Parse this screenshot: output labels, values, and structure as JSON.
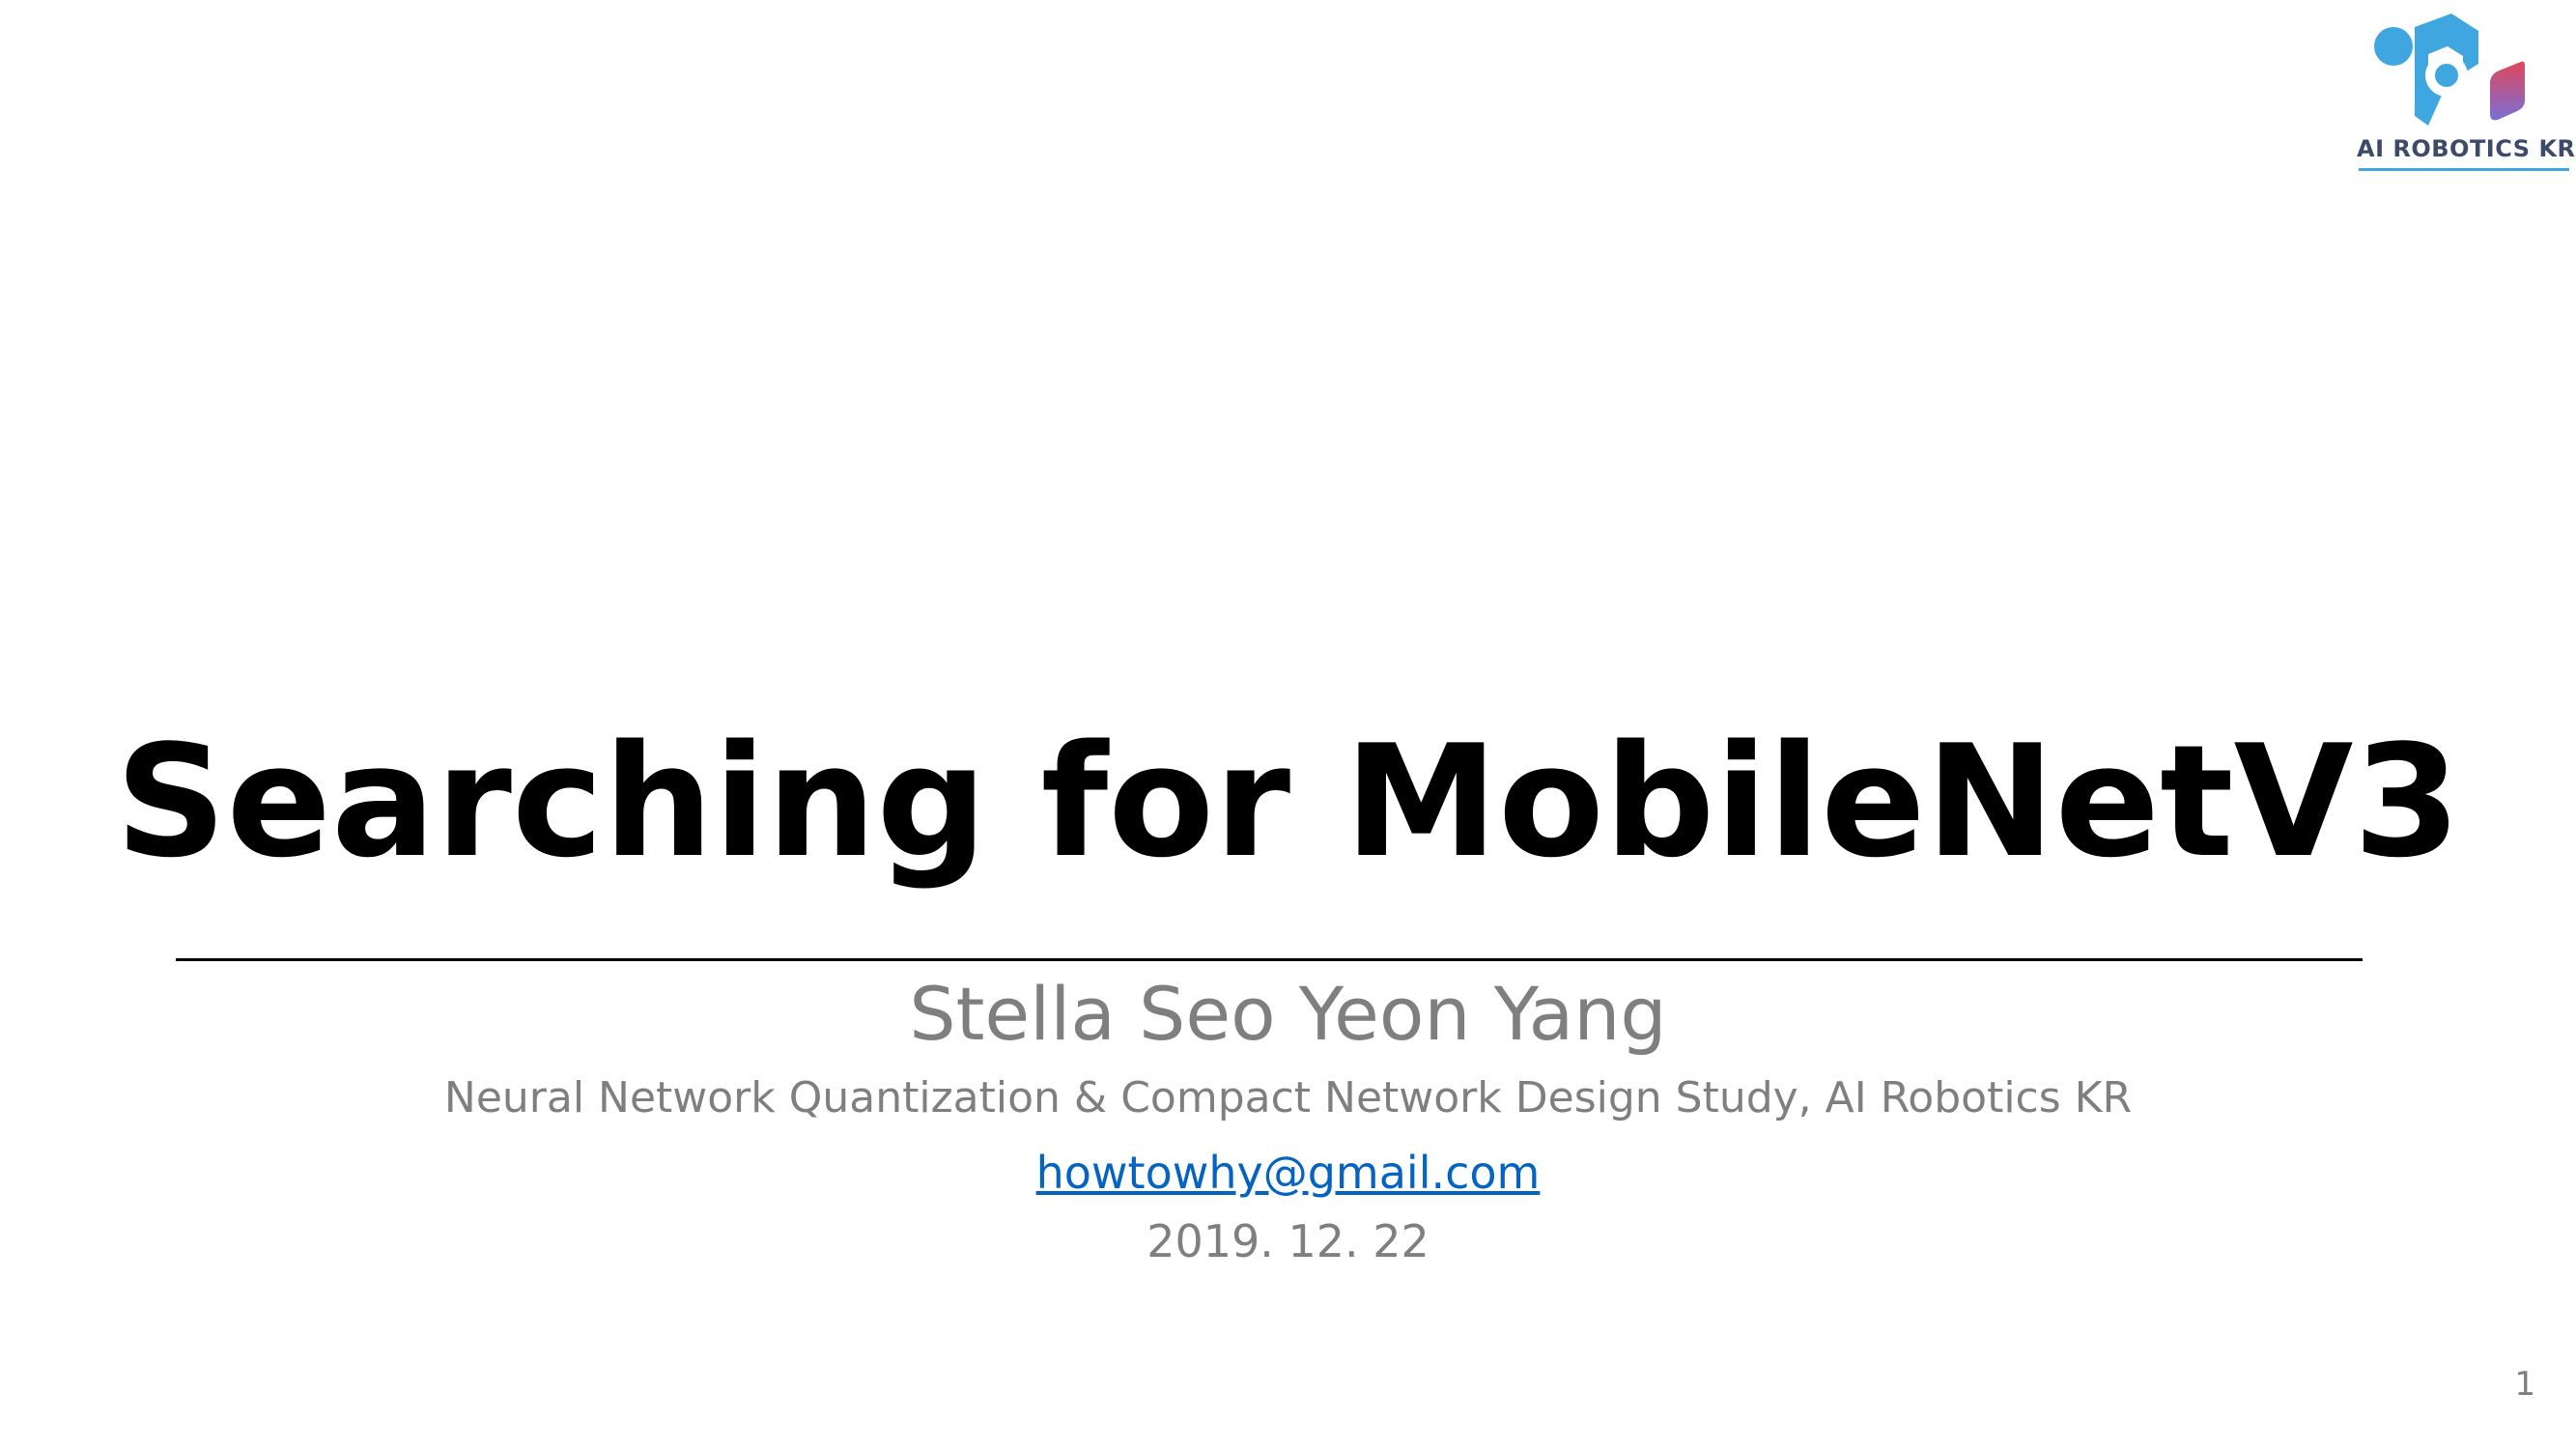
{
  "logo": {
    "text": "AI ROBOTICS KR",
    "icon": "ai-robotics-kr-logo-icon",
    "colors": {
      "primary_blue": "#3fa6e0",
      "gradient_start": "#3fa6e0",
      "gradient_end": "#e0475a",
      "text": "#3d4b6b"
    }
  },
  "title": "Searching for MobileNetV3",
  "author": "Stella Seo Yeon Yang",
  "affiliation": "Neural Network Quantization & Compact Network Design Study, AI Robotics KR",
  "email": "howtowhy@gmail.com",
  "date": "2019. 12. 22",
  "page_number": "1",
  "colors": {
    "title": "#000000",
    "secondary_text": "#7f7f7f",
    "link": "#0563c1",
    "background": "#ffffff"
  }
}
